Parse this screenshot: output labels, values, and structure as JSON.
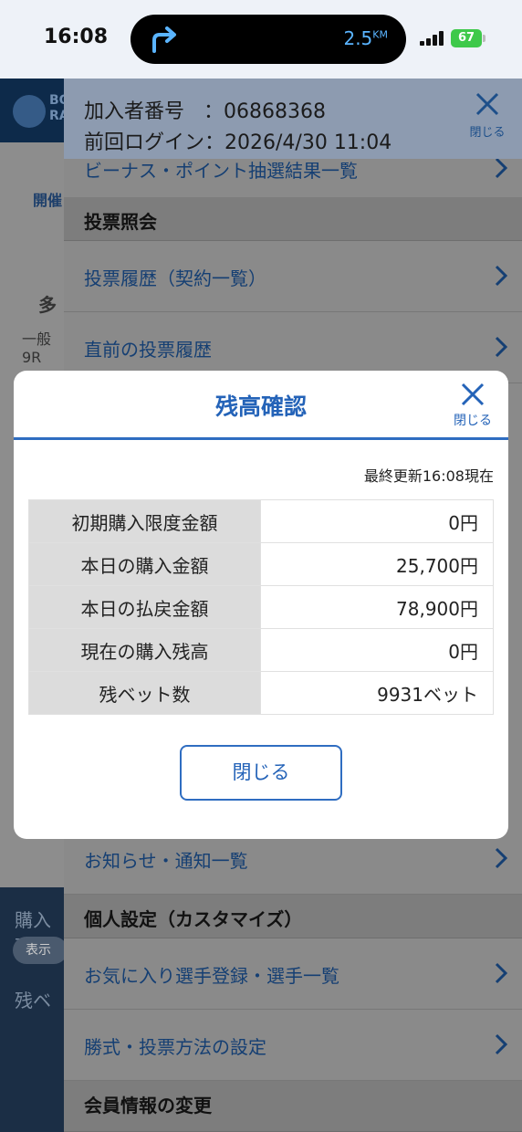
{
  "status_bar": {
    "time": "16:08",
    "distance": "2.5",
    "distance_unit": "KM",
    "battery": "67"
  },
  "background": {
    "logo_text_1": "BO",
    "logo_text_2": "RA",
    "frag_1": "開催",
    "frag_2": "多",
    "frag_3": "一般",
    "frag_4": "9R",
    "frag_5": "購入残",
    "frag_6": "表示",
    "frag_7": "残ベ"
  },
  "menu": {
    "member_no_label": "加入者番号",
    "member_no_value": "：06868368",
    "last_login_label": "前回ログイン",
    "last_login_value": "：2026/4/30 11:04",
    "close_label": "閉じる",
    "partial_item": "ビーナス・ポイント抽選結果一覧",
    "sections": {
      "vote_inquiry": "投票照会",
      "personal": "個人設定（カスタマイズ）",
      "member_info": "会員情報の変更"
    },
    "items": {
      "history": "投票履歴（契約一覧）",
      "recent": "直前の投票履歴",
      "notices": "お知らせ・通知一覧",
      "favorites": "お気に入り選手登録・選手一覧",
      "bet_settings": "勝式・投票方法の設定"
    }
  },
  "modal": {
    "title": "残高確認",
    "close_label": "閉じる",
    "updated": "最終更新16:08現在",
    "rows": [
      {
        "label": "初期購入限度金額",
        "value": "0円"
      },
      {
        "label": "本日の購入金額",
        "value": "25,700円"
      },
      {
        "label": "本日の払戻金額",
        "value": "78,900円"
      },
      {
        "label": "現在の購入残高",
        "value": "0円"
      },
      {
        "label": "残ベット数",
        "value": "9931ベット"
      }
    ],
    "close_button": "閉じる"
  },
  "colors": {
    "accent": "#2463b8",
    "overlay": "#8a8a8a"
  }
}
